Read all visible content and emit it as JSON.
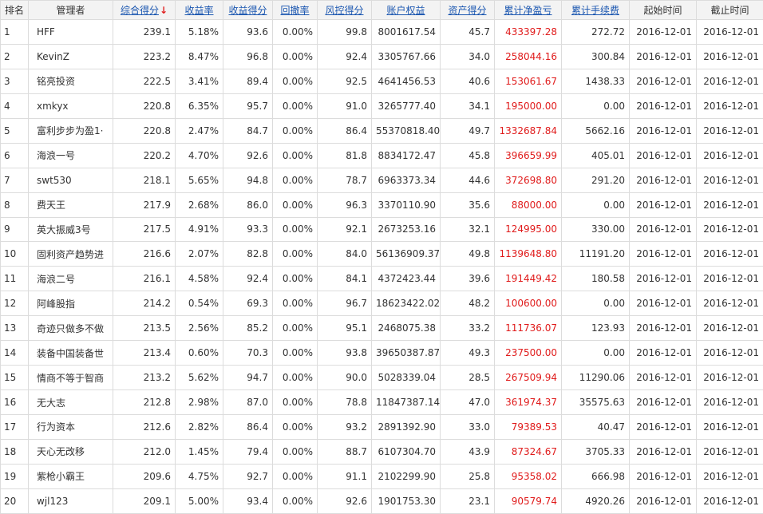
{
  "headers": {
    "rank": "排名",
    "manager": "管理者",
    "score": "综合得分",
    "return_rate": "收益率",
    "return_score": "收益得分",
    "drawdown": "回撤率",
    "risk_score": "风控得分",
    "equity": "账户权益",
    "asset_score": "资产得分",
    "net_pnl": "累计净盈亏",
    "fees": "累计手续费",
    "start_date": "起始时间",
    "end_date": "截止时间",
    "sort_arrow": "↓"
  },
  "rows": [
    {
      "rank": "1",
      "manager": "HFF",
      "score": "239.1",
      "return_rate": "5.18%",
      "return_score": "93.6",
      "drawdown": "0.00%",
      "risk_score": "99.8",
      "equity": "8001617.54",
      "asset_score": "45.7",
      "net_pnl": "433397.28",
      "fees": "272.72",
      "start_date": "2016-12-01",
      "end_date": "2016-12-01"
    },
    {
      "rank": "2",
      "manager": "KevinZ",
      "score": "223.2",
      "return_rate": "8.47%",
      "return_score": "96.8",
      "drawdown": "0.00%",
      "risk_score": "92.4",
      "equity": "3305767.66",
      "asset_score": "34.0",
      "net_pnl": "258044.16",
      "fees": "300.84",
      "start_date": "2016-12-01",
      "end_date": "2016-12-01"
    },
    {
      "rank": "3",
      "manager": "铭亮投资",
      "score": "222.5",
      "return_rate": "3.41%",
      "return_score": "89.4",
      "drawdown": "0.00%",
      "risk_score": "92.5",
      "equity": "4641456.53",
      "asset_score": "40.6",
      "net_pnl": "153061.67",
      "fees": "1438.33",
      "start_date": "2016-12-01",
      "end_date": "2016-12-01"
    },
    {
      "rank": "4",
      "manager": "xmkyx",
      "score": "220.8",
      "return_rate": "6.35%",
      "return_score": "95.7",
      "drawdown": "0.00%",
      "risk_score": "91.0",
      "equity": "3265777.40",
      "asset_score": "34.1",
      "net_pnl": "195000.00",
      "fees": "0.00",
      "start_date": "2016-12-01",
      "end_date": "2016-12-01"
    },
    {
      "rank": "5",
      "manager": "富利步步为盈1·",
      "score": "220.8",
      "return_rate": "2.47%",
      "return_score": "84.7",
      "drawdown": "0.00%",
      "risk_score": "86.4",
      "equity": "55370818.40",
      "asset_score": "49.7",
      "net_pnl": "1332687.84",
      "fees": "5662.16",
      "start_date": "2016-12-01",
      "end_date": "2016-12-01"
    },
    {
      "rank": "6",
      "manager": "海浪一号",
      "score": "220.2",
      "return_rate": "4.70%",
      "return_score": "92.6",
      "drawdown": "0.00%",
      "risk_score": "81.8",
      "equity": "8834172.47",
      "asset_score": "45.8",
      "net_pnl": "396659.99",
      "fees": "405.01",
      "start_date": "2016-12-01",
      "end_date": "2016-12-01"
    },
    {
      "rank": "7",
      "manager": "swt530",
      "score": "218.1",
      "return_rate": "5.65%",
      "return_score": "94.8",
      "drawdown": "0.00%",
      "risk_score": "78.7",
      "equity": "6963373.34",
      "asset_score": "44.6",
      "net_pnl": "372698.80",
      "fees": "291.20",
      "start_date": "2016-12-01",
      "end_date": "2016-12-01"
    },
    {
      "rank": "8",
      "manager": "费天王",
      "score": "217.9",
      "return_rate": "2.68%",
      "return_score": "86.0",
      "drawdown": "0.00%",
      "risk_score": "96.3",
      "equity": "3370110.90",
      "asset_score": "35.6",
      "net_pnl": "88000.00",
      "fees": "0.00",
      "start_date": "2016-12-01",
      "end_date": "2016-12-01"
    },
    {
      "rank": "9",
      "manager": "英大振威3号",
      "score": "217.5",
      "return_rate": "4.91%",
      "return_score": "93.3",
      "drawdown": "0.00%",
      "risk_score": "92.1",
      "equity": "2673253.16",
      "asset_score": "32.1",
      "net_pnl": "124995.00",
      "fees": "330.00",
      "start_date": "2016-12-01",
      "end_date": "2016-12-01"
    },
    {
      "rank": "10",
      "manager": "固利资产趋势进",
      "score": "216.6",
      "return_rate": "2.07%",
      "return_score": "82.8",
      "drawdown": "0.00%",
      "risk_score": "84.0",
      "equity": "56136909.37",
      "asset_score": "49.8",
      "net_pnl": "1139648.80",
      "fees": "11191.20",
      "start_date": "2016-12-01",
      "end_date": "2016-12-01"
    },
    {
      "rank": "11",
      "manager": "海浪二号",
      "score": "216.1",
      "return_rate": "4.58%",
      "return_score": "92.4",
      "drawdown": "0.00%",
      "risk_score": "84.1",
      "equity": "4372423.44",
      "asset_score": "39.6",
      "net_pnl": "191449.42",
      "fees": "180.58",
      "start_date": "2016-12-01",
      "end_date": "2016-12-01"
    },
    {
      "rank": "12",
      "manager": "阿峰股指",
      "score": "214.2",
      "return_rate": "0.54%",
      "return_score": "69.3",
      "drawdown": "0.00%",
      "risk_score": "96.7",
      "equity": "18623422.02",
      "asset_score": "48.2",
      "net_pnl": "100600.00",
      "fees": "0.00",
      "start_date": "2016-12-01",
      "end_date": "2016-12-01"
    },
    {
      "rank": "13",
      "manager": "奇迹只做多不做",
      "score": "213.5",
      "return_rate": "2.56%",
      "return_score": "85.2",
      "drawdown": "0.00%",
      "risk_score": "95.1",
      "equity": "2468075.38",
      "asset_score": "33.2",
      "net_pnl": "111736.07",
      "fees": "123.93",
      "start_date": "2016-12-01",
      "end_date": "2016-12-01"
    },
    {
      "rank": "14",
      "manager": "装备中国装备世",
      "score": "213.4",
      "return_rate": "0.60%",
      "return_score": "70.3",
      "drawdown": "0.00%",
      "risk_score": "93.8",
      "equity": "39650387.87",
      "asset_score": "49.3",
      "net_pnl": "237500.00",
      "fees": "0.00",
      "start_date": "2016-12-01",
      "end_date": "2016-12-01"
    },
    {
      "rank": "15",
      "manager": "情商不等于智商",
      "score": "213.2",
      "return_rate": "5.62%",
      "return_score": "94.7",
      "drawdown": "0.00%",
      "risk_score": "90.0",
      "equity": "5028339.04",
      "asset_score": "28.5",
      "net_pnl": "267509.94",
      "fees": "11290.06",
      "start_date": "2016-12-01",
      "end_date": "2016-12-01"
    },
    {
      "rank": "16",
      "manager": "无大志",
      "score": "212.8",
      "return_rate": "2.98%",
      "return_score": "87.0",
      "drawdown": "0.00%",
      "risk_score": "78.8",
      "equity": "11847387.14",
      "asset_score": "47.0",
      "net_pnl": "361974.37",
      "fees": "35575.63",
      "start_date": "2016-12-01",
      "end_date": "2016-12-01"
    },
    {
      "rank": "17",
      "manager": "行为资本",
      "score": "212.6",
      "return_rate": "2.82%",
      "return_score": "86.4",
      "drawdown": "0.00%",
      "risk_score": "93.2",
      "equity": "2891392.90",
      "asset_score": "33.0",
      "net_pnl": "79389.53",
      "fees": "40.47",
      "start_date": "2016-12-01",
      "end_date": "2016-12-01"
    },
    {
      "rank": "18",
      "manager": "天心无改移",
      "score": "212.0",
      "return_rate": "1.45%",
      "return_score": "79.4",
      "drawdown": "0.00%",
      "risk_score": "88.7",
      "equity": "6107304.70",
      "asset_score": "43.9",
      "net_pnl": "87324.67",
      "fees": "3705.33",
      "start_date": "2016-12-01",
      "end_date": "2016-12-01"
    },
    {
      "rank": "19",
      "manager": "紫枪小霸王",
      "score": "209.6",
      "return_rate": "4.75%",
      "return_score": "92.7",
      "drawdown": "0.00%",
      "risk_score": "91.1",
      "equity": "2102299.90",
      "asset_score": "25.8",
      "net_pnl": "95358.02",
      "fees": "666.98",
      "start_date": "2016-12-01",
      "end_date": "2016-12-01"
    },
    {
      "rank": "20",
      "manager": "wjl123",
      "score": "209.1",
      "return_rate": "5.00%",
      "return_score": "93.4",
      "drawdown": "0.00%",
      "risk_score": "92.6",
      "equity": "1901753.30",
      "asset_score": "23.1",
      "net_pnl": "90579.74",
      "fees": "4920.26",
      "start_date": "2016-12-01",
      "end_date": "2016-12-01"
    }
  ],
  "colors": {
    "header_link": "#1a56b0",
    "profit": "#e01b1b",
    "sort_arrow": "#e02020",
    "header_bg": "#f3f3f3",
    "border": "#dcdcdc"
  }
}
